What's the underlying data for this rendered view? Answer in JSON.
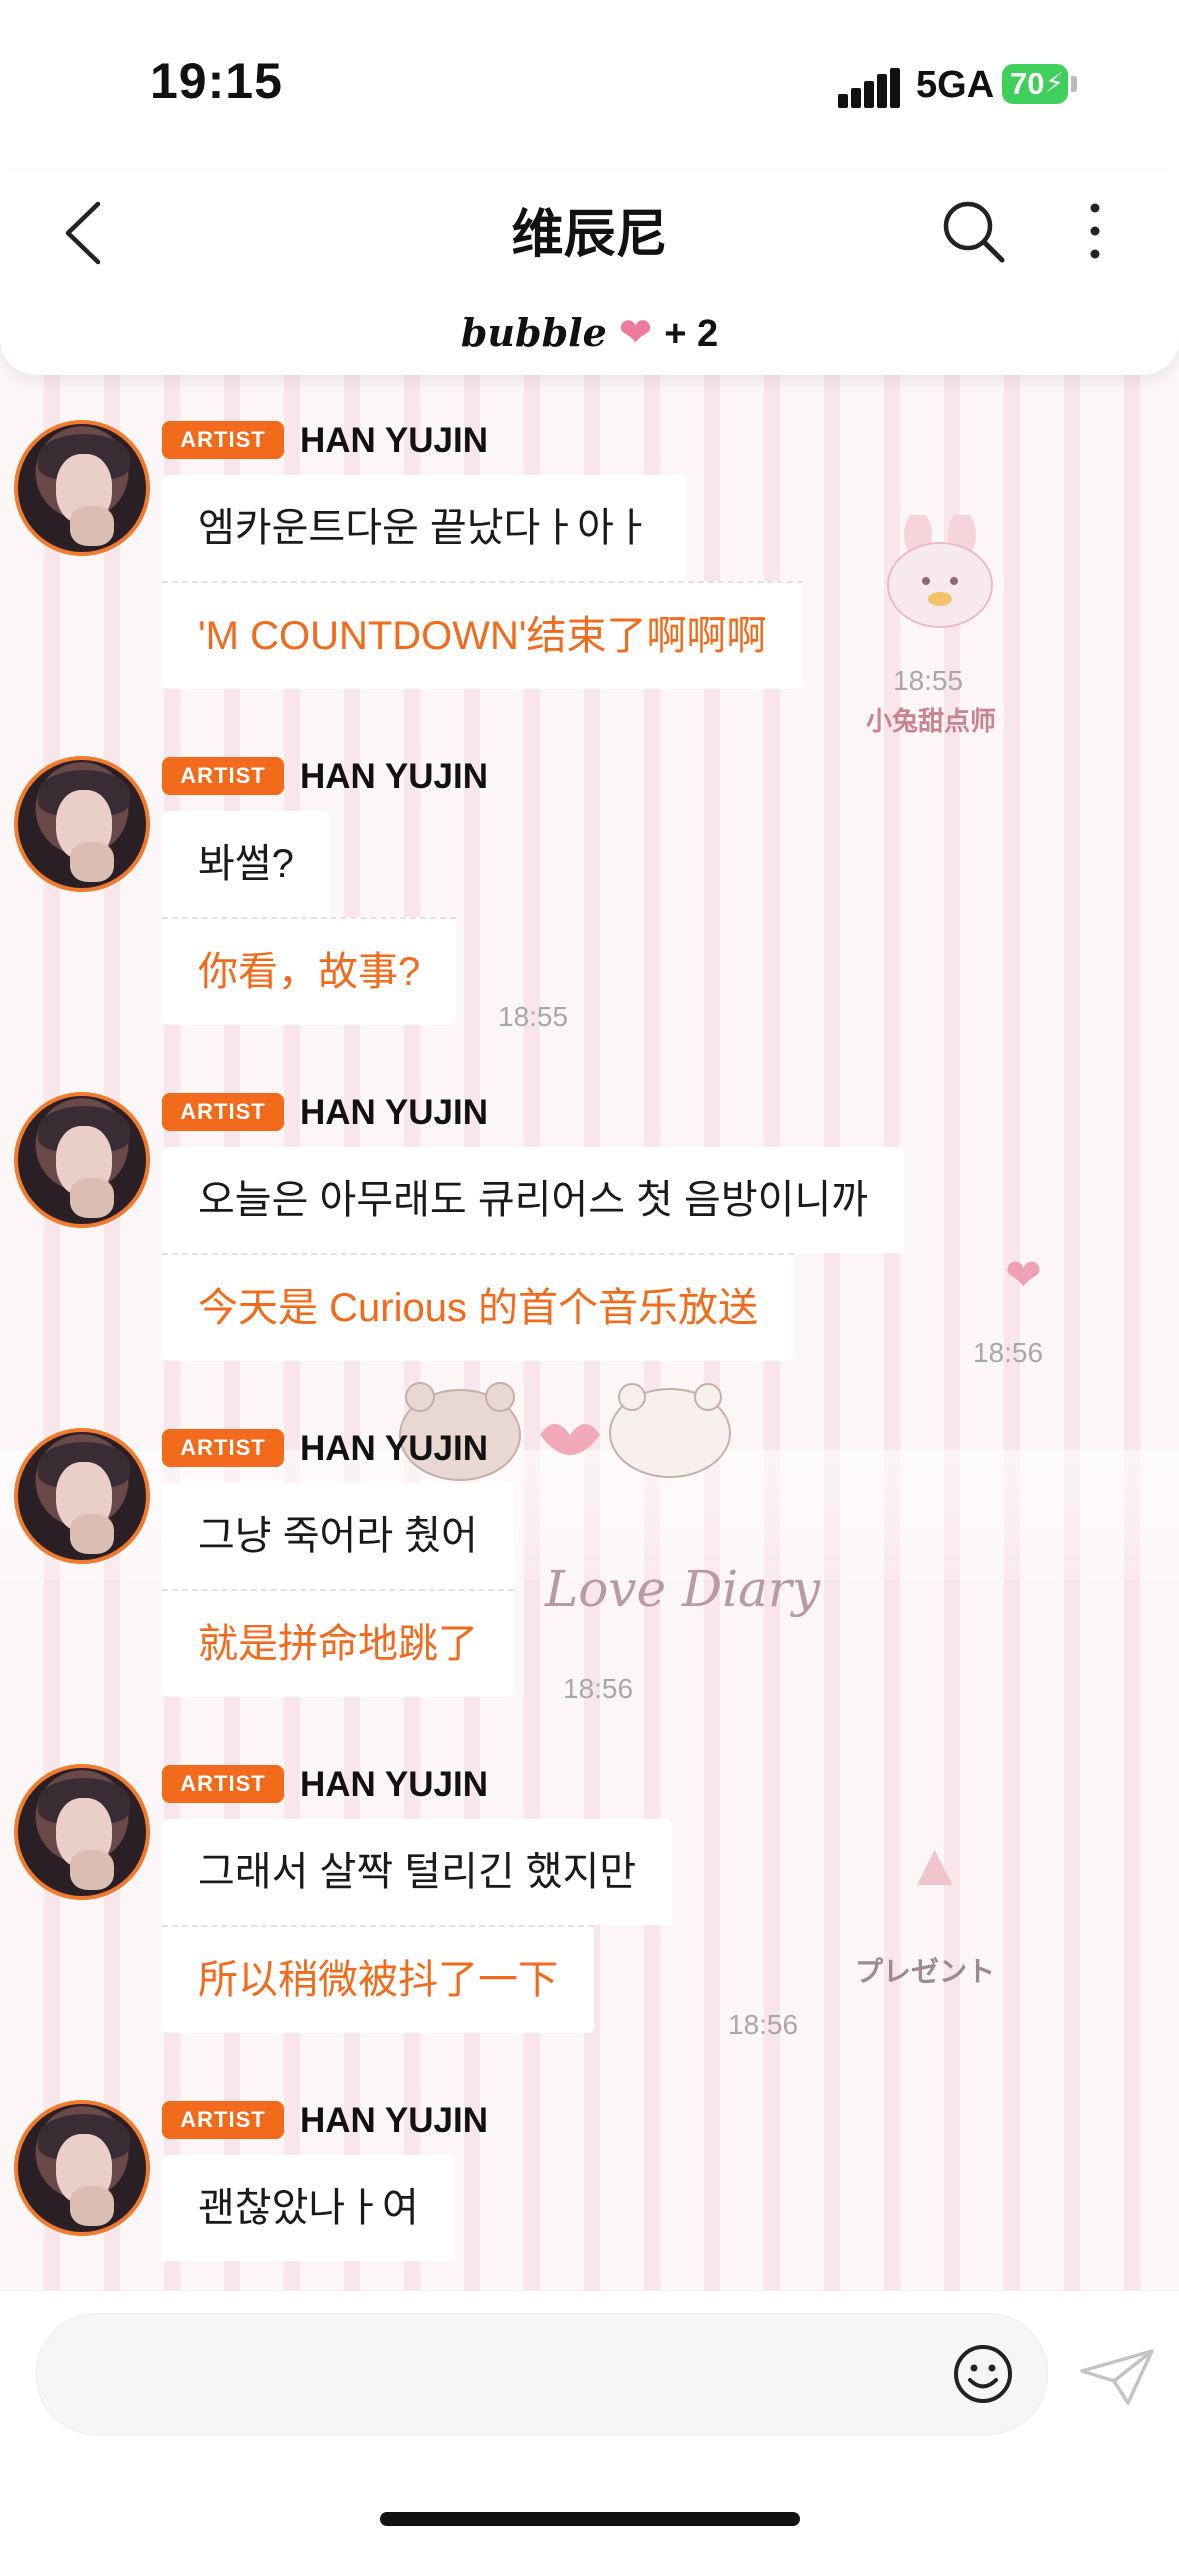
{
  "status_bar": {
    "time": "19:15",
    "network": "5GA",
    "battery": "70"
  },
  "header": {
    "title": "维辰尼",
    "subtitle_word": "bubble",
    "subtitle_count": "+ 2"
  },
  "decor": {
    "sticker_1": "小兔甜点师",
    "sticker_2": "Love Diary",
    "sticker_3": "プレゼント"
  },
  "messages": [
    {
      "badge": "ARTIST",
      "sender": "HAN YUJIN",
      "korean": "엠카운트다운 끝났다ㅏ아ㅏ",
      "chinese": "'M COUNTDOWN'结束了啊啊啊",
      "time": "18:55"
    },
    {
      "badge": "ARTIST",
      "sender": "HAN YUJIN",
      "korean": "봐썰?",
      "chinese": "你看，故事?",
      "time": "18:55"
    },
    {
      "badge": "ARTIST",
      "sender": "HAN YUJIN",
      "korean": "오늘은 아무래도 큐리어스 첫 음방이니까",
      "chinese": "今天是 Curious 的首个音乐放送",
      "time": "18:56"
    },
    {
      "badge": "ARTIST",
      "sender": "HAN YUJIN",
      "korean": "그냥 죽어라 췄어",
      "chinese": "就是拼命地跳了",
      "time": "18:56"
    },
    {
      "badge": "ARTIST",
      "sender": "HAN YUJIN",
      "korean": "그래서 살짝 털리긴 했지만",
      "chinese": "所以稍微被抖了一下",
      "time": "18:56"
    },
    {
      "badge": "ARTIST",
      "sender": "HAN YUJIN",
      "korean": "괜찮았나ㅏ여",
      "chinese": "",
      "time": ""
    }
  ],
  "colors": {
    "accent": "#f26a1b",
    "battery": "#3fcf5b"
  },
  "icons": [
    "back-arrow-icon",
    "search-icon",
    "more-vertical-icon",
    "heart-icon",
    "emoji-icon",
    "send-icon"
  ]
}
